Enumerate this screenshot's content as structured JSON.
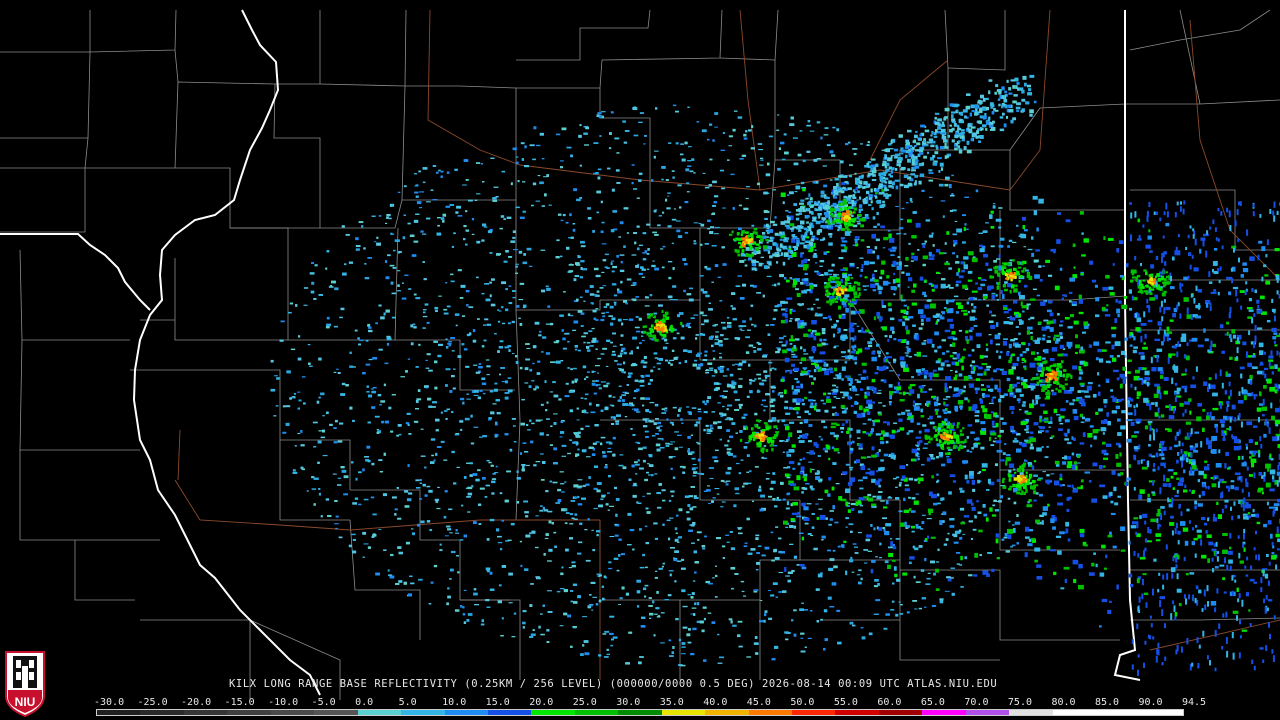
{
  "caption": "KILX LONG RANGE BASE REFLECTIVITY (0.25KM / 256 LEVEL) (000000/0000 0.5 DEG) 2026-08-14 00:09 UTC  ATLAS.NIU.EDU",
  "logo_text": "NIU",
  "scale": {
    "labels": [
      "-30.0",
      "-25.0",
      "-20.0",
      "-15.0",
      "-10.0",
      "-5.0",
      "0.0",
      "5.0",
      "10.0",
      "15.0",
      "20.0",
      "25.0",
      "30.0",
      "35.0",
      "40.0",
      "45.0",
      "50.0",
      "55.0",
      "60.0",
      "65.0",
      "70.0",
      "75.0",
      "80.0",
      "85.0",
      "90.0",
      "94.5"
    ],
    "colors": [
      "#202020",
      "#2a2a2a",
      "#353535",
      "#404040",
      "#4a4a4a",
      "#555555",
      "#5bd0d0",
      "#33b5e5",
      "#1e8cf0",
      "#1450e6",
      "#00e600",
      "#00c000",
      "#008c00",
      "#e6e600",
      "#f0b400",
      "#ff7800",
      "#ff2800",
      "#d00000",
      "#a00000",
      "#ff00ff",
      "#b050e6",
      "#e0e0e0",
      "#ffffff",
      "#ffffff",
      "#ffffff"
    ]
  },
  "colors": {
    "background": "#000000",
    "state_border": "#ffffff",
    "county_line": "#9a9a9a",
    "highway": "#8b4a2b"
  },
  "radar": {
    "site": "KILX"
  }
}
